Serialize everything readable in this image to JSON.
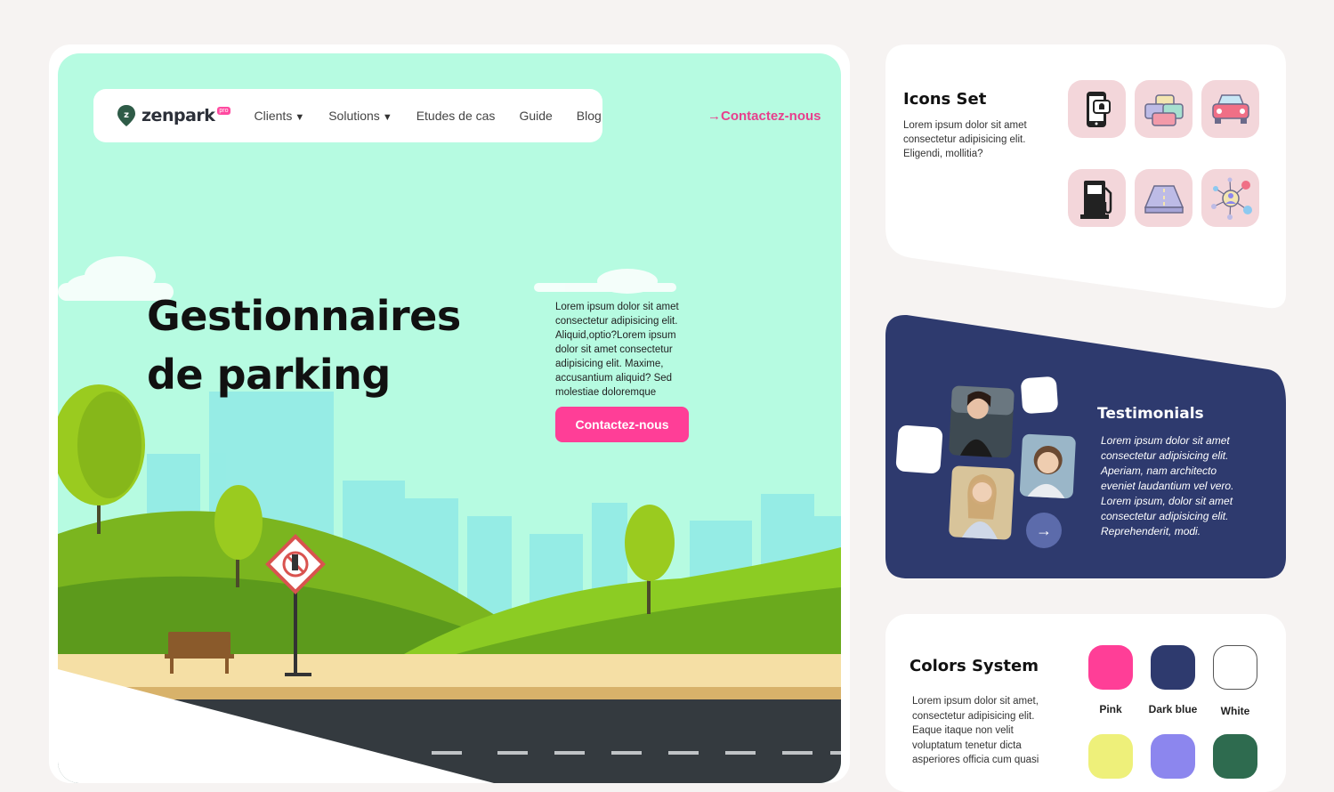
{
  "hero": {
    "nav": {
      "logo_text": "zenpark",
      "logo_badge": "pro",
      "items": [
        {
          "label": "Clients",
          "caret": "▼"
        },
        {
          "label": "Solutions",
          "caret": "▼"
        },
        {
          "label": "Etudes de cas"
        },
        {
          "label": "Guide"
        },
        {
          "label": "Blog"
        }
      ]
    },
    "contact_link": "→Contactez-nous",
    "title_line1": "Gestionnaires",
    "title_line2": "de parking",
    "description": "Lorem ipsum dolor sit amet consectetur adipisicing elit. Aliquid,optio?Lorem ipsum dolor sit amet consectetur adipisicing elit. Maxime, accusantium aliquid? Sed molestiae doloremque",
    "cta_label": "Contactez-nous"
  },
  "icons_set": {
    "title": "Icons Set",
    "description": "Lorem ipsum dolor sit amet consectetur adipisicing elit. Eligendi, mollitia?",
    "icons": [
      "phone-notification-icon",
      "traffic-jam-icon",
      "car-front-icon",
      "fuel-pump-icon",
      "parking-road-icon",
      "network-user-icon"
    ]
  },
  "testimonials": {
    "title": "Testimonials",
    "text": "Lorem ipsum dolor sit amet consectetur adipisicing elit. Aperiam, nam architecto eveniet laudantium vel vero. Lorem ipsum, dolor sit amet consectetur adipisicing elit. Reprehenderit, modi.",
    "arrow": "→"
  },
  "colors_system": {
    "title": "Colors System",
    "description": "Lorem ipsum dolor sit amet, consectetur adipisicing elit. Eaque itaque non velit voluptatum tenetur dicta asperiores officia cum quasi",
    "swatches": [
      {
        "name": "Pink",
        "hex": "#ff3e97"
      },
      {
        "name": "Dark blue",
        "hex": "#2e3a6e"
      },
      {
        "name": "White",
        "hex": "#ffffff"
      },
      {
        "name": "",
        "hex": "#eef07a"
      },
      {
        "name": "",
        "hex": "#8c86ee"
      },
      {
        "name": "",
        "hex": "#2e6b4f"
      }
    ]
  },
  "colors": {
    "background": "#f6f3f2",
    "hero_sky": "#b6fbe1",
    "accent_pink": "#ff3e97",
    "dark_blue": "#2e3a6e",
    "icon_tile": "#f3d6da"
  }
}
